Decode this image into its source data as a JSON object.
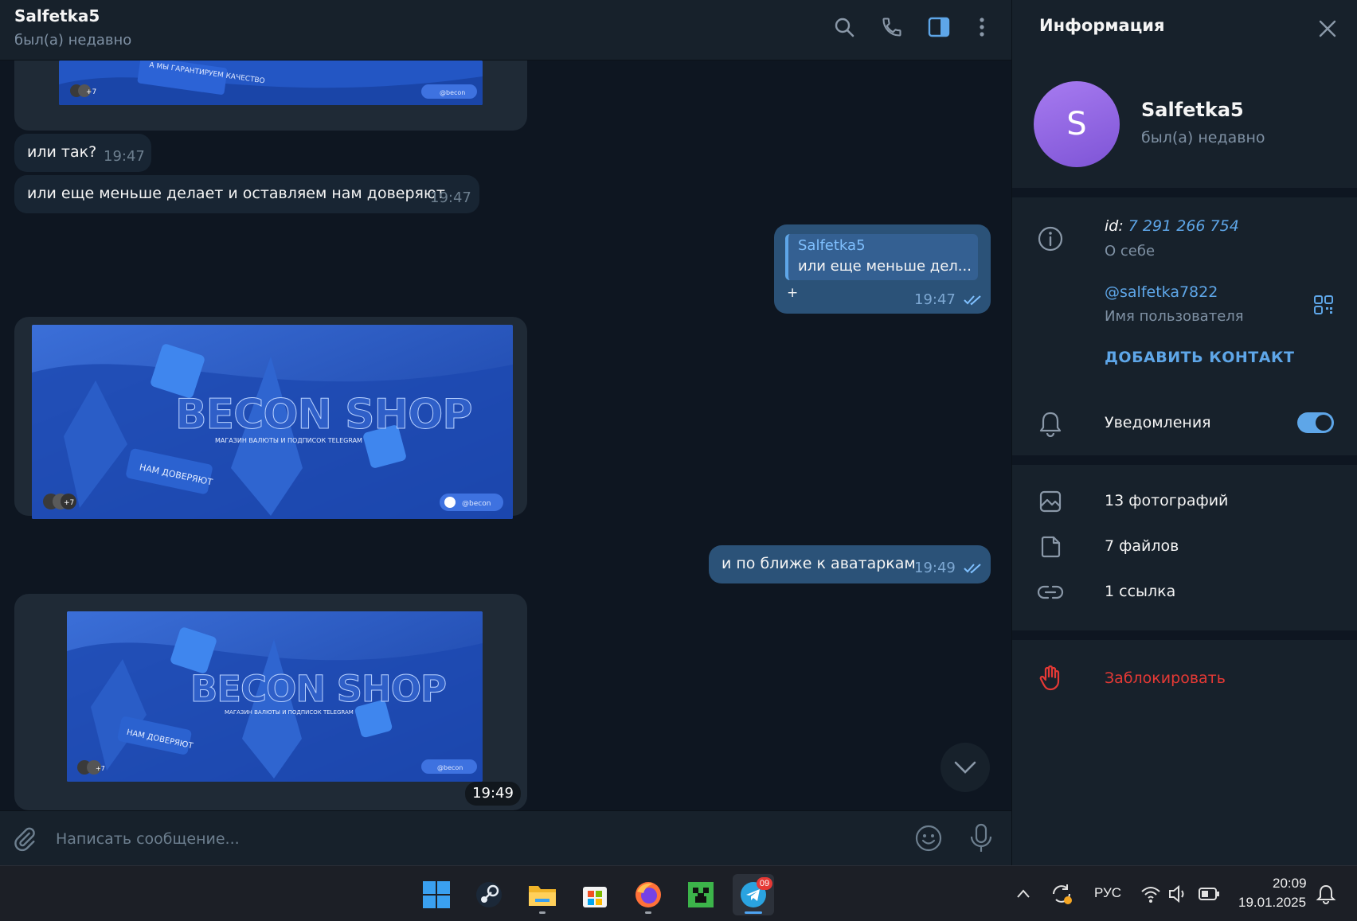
{
  "chat": {
    "title": "Salfetka5",
    "status": "был(а) недавно",
    "messages": [
      {
        "text": "или так?",
        "time": "19:47"
      },
      {
        "text": "или еще меньше делает и оставляем нам доверяют",
        "time": "19:47"
      },
      {
        "reply_author": "Salfetka5",
        "reply_text": "или еще меньше дел...",
        "text": "+",
        "time": "19:47"
      },
      {
        "text": "и по ближе к аватаркам",
        "time": "19:49"
      },
      {
        "time": "19:49"
      }
    ],
    "banner": {
      "title": "BECON SHOP",
      "subtitle": "МАГАЗИН ВАЛЮТЫ И ПОДПИСОК TELEGRAM",
      "badge": "НАМ ДОВЕРЯЮТ",
      "badge_top": "А МЫ ГАРАНТИРУЕМ КАЧЕСТВО",
      "handle": "@becon",
      "avatars_count": "+7"
    },
    "composer_placeholder": "Написать сообщение..."
  },
  "info": {
    "title": "Информация",
    "name": "Salfetka5",
    "status": "был(а) недавно",
    "avatar_letter": "S",
    "id_label": "id:",
    "id_value": "7 291 266 754",
    "about_label": "О себе",
    "username": "@salfetka7822",
    "username_label": "Имя пользователя",
    "add_contact": "ДОБАВИТЬ КОНТАКТ",
    "notifications": "Уведомления",
    "notifications_on": true,
    "photos": "13 фотографий",
    "files": "7 файлов",
    "links": "1 ссылка",
    "block": "Заблокировать"
  },
  "taskbar": {
    "lang": "РУС",
    "time": "20:09",
    "date": "19.01.2025",
    "telegram_badge": "09"
  },
  "colors": {
    "accent": "#5ea6e8",
    "out_bubble": "#2b5278",
    "in_bubble": "#182533",
    "danger": "#e53935"
  }
}
